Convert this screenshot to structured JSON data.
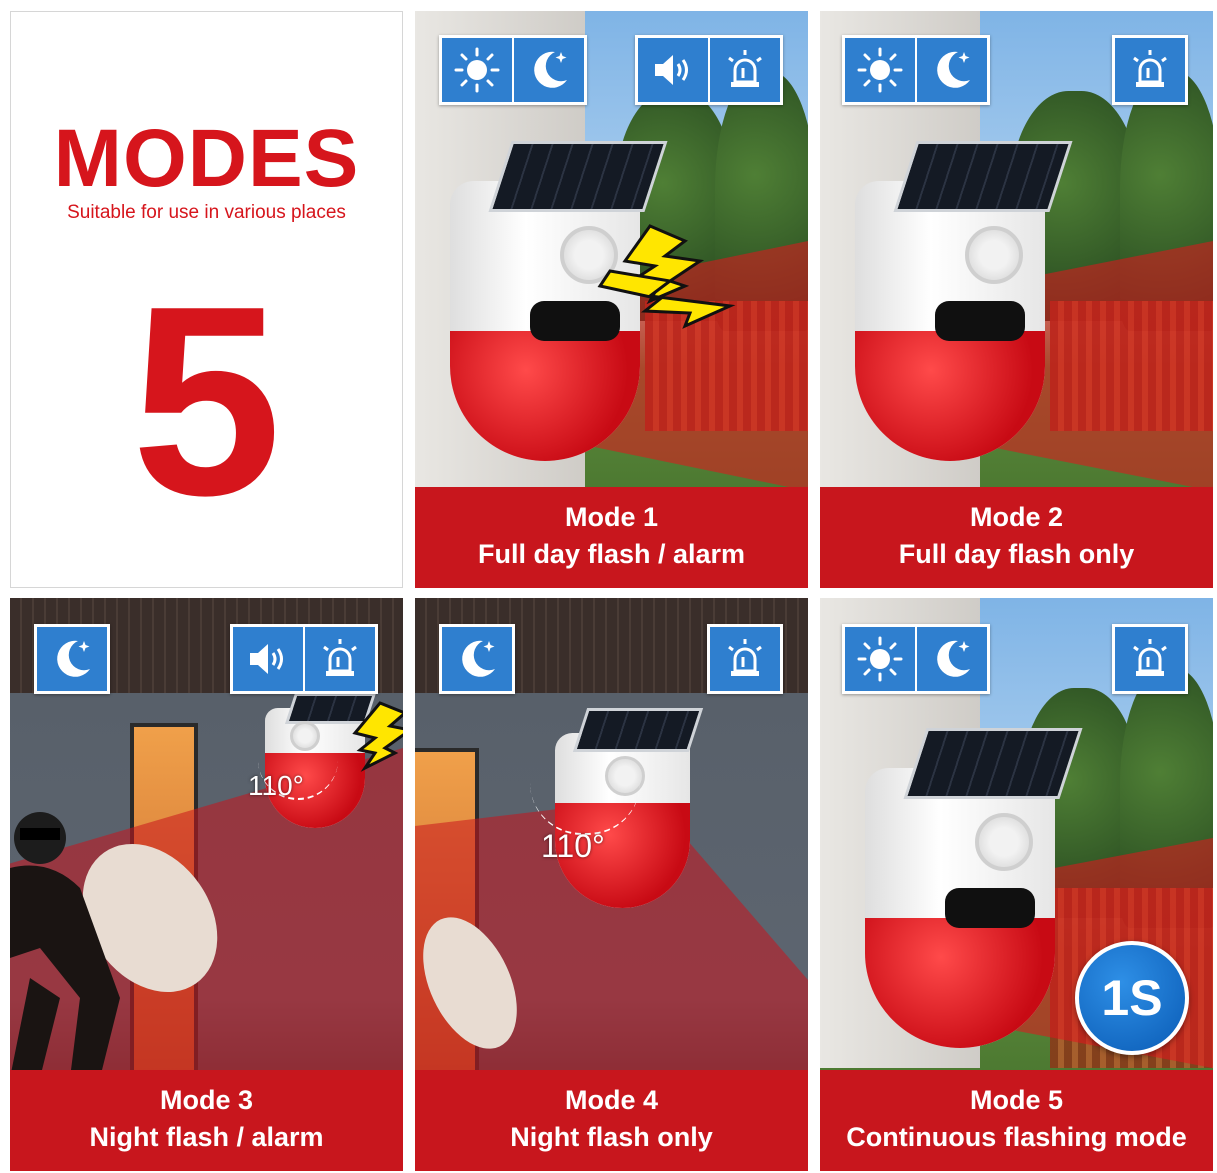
{
  "intro": {
    "title": "MODES",
    "subtitle": "Suitable for use in various places",
    "count": "5"
  },
  "colors": {
    "brand_red": "#c8161d",
    "icon_blue": "#2f7fcf",
    "badge_blue": "#1a6fcc"
  },
  "panels": [
    {
      "line1": "Mode 1",
      "line2": "Full day flash / alarm",
      "icons_left": [
        "sun-icon",
        "moon-icon"
      ],
      "icons_right": [
        "speaker-icon",
        "siren-icon"
      ]
    },
    {
      "line1": "Mode 2",
      "line2": "Full day flash only",
      "icons_left": [
        "sun-icon",
        "moon-icon"
      ],
      "icons_right": [
        "siren-icon"
      ]
    },
    {
      "line1": "Mode 3",
      "line2": "Night flash / alarm",
      "icons_left": [
        "moon-icon"
      ],
      "icons_right": [
        "speaker-icon",
        "siren-icon"
      ],
      "angle": "110°"
    },
    {
      "line1": "Mode 4",
      "line2": "Night flash only",
      "icons_left": [
        "moon-icon"
      ],
      "icons_right": [
        "siren-icon"
      ],
      "angle": "110°"
    },
    {
      "line1": "Mode 5",
      "line2": "Continuous flashing mode",
      "icons_left": [
        "sun-icon",
        "moon-icon"
      ],
      "icons_right": [
        "siren-icon"
      ],
      "badge": "1S"
    }
  ]
}
